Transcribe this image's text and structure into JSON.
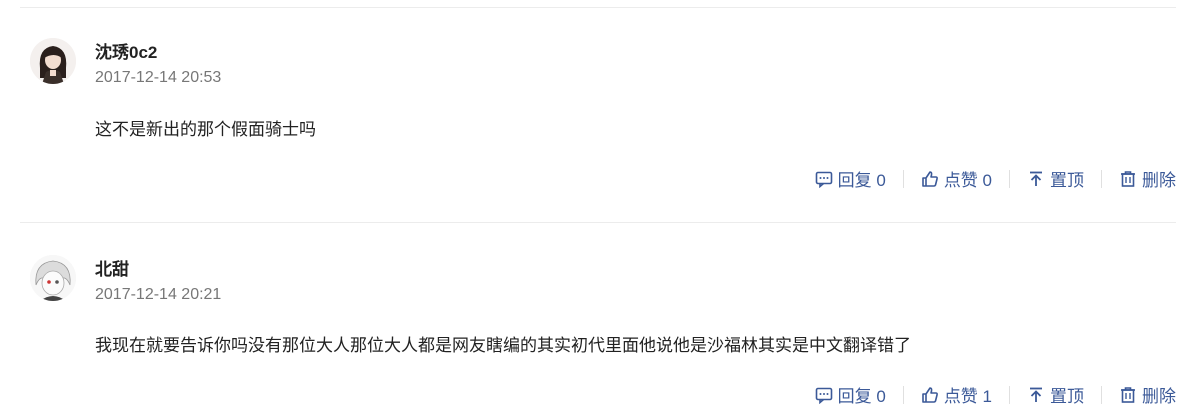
{
  "comments": [
    {
      "username": "沈琇0c2",
      "timestamp": "2017-12-14 20:53",
      "content": "这不是新出的那个假面骑士吗",
      "actions": {
        "reply_label": "回复 0",
        "like_label": "点赞 0",
        "pin_label": "置顶",
        "delete_label": "删除"
      }
    },
    {
      "username": "北甜",
      "timestamp": "2017-12-14 20:21",
      "content": "我现在就要告诉你吗没有那位大人那位大人都是网友瞎编的其实初代里面他说他是沙福林其实是中文翻译错了",
      "actions": {
        "reply_label": "回复 0",
        "like_label": "点赞 1",
        "pin_label": "置顶",
        "delete_label": "删除"
      }
    }
  ],
  "colors": {
    "accent": "#3b5998",
    "text": "#222222",
    "muted": "#777777"
  },
  "icons": [
    "comment-icon",
    "thumbs-up-icon",
    "pin-top-icon",
    "trash-icon"
  ]
}
